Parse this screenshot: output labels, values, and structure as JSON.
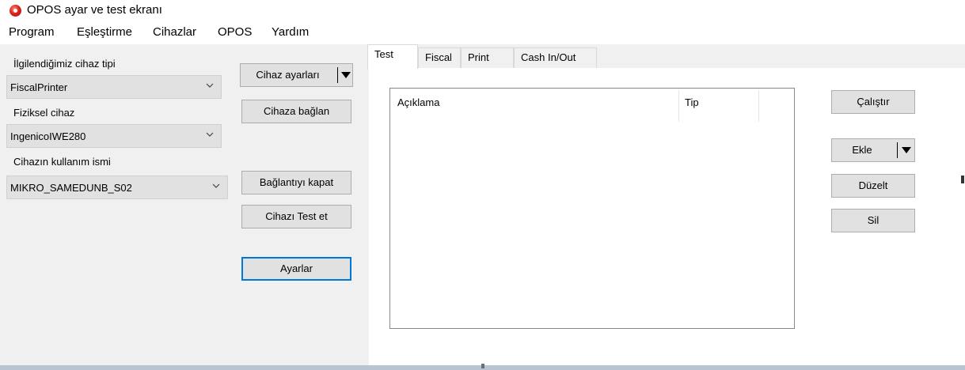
{
  "window": {
    "title": "OPOS ayar ve test ekranı"
  },
  "menu": [
    "Program",
    "Eşleştirme",
    "Cihazlar",
    "OPOS",
    "Yardım"
  ],
  "left": {
    "device_type_label": "İlgilendiğimiz cihaz tipi",
    "device_type_value": "FiscalPrinter",
    "physical_device_label": "Fiziksel cihaz",
    "physical_device_value": "IngenicoIWE280",
    "usage_name_label": "Cihazın kullanım ismi",
    "usage_name_value": "MIKRO_SAMEDUNB_S02"
  },
  "buttons": {
    "device_settings": "Cihaz ayarları",
    "connect": "Cihaza bağlan",
    "close_connection": "Bağlantıyı kapat",
    "test_device": "Cihazı Test et",
    "settings": "Ayarlar"
  },
  "tabs": [
    "Test",
    "Fiscal",
    "Print",
    "Cash In/Out"
  ],
  "list": {
    "columns": [
      "Açıklama",
      "Tip"
    ]
  },
  "actions": {
    "run": "Çalıştır",
    "add": "Ekle",
    "edit": "Düzelt",
    "delete": "Sil"
  },
  "icons": {
    "app": "opos-app-icon",
    "dropdown": "chevron-down-icon",
    "split": "triangle-down-icon"
  },
  "colors": {
    "panel": "#f0f0f0",
    "button": "#e1e1e1",
    "focus": "#0078d7",
    "app_icon": "#e0241a"
  }
}
